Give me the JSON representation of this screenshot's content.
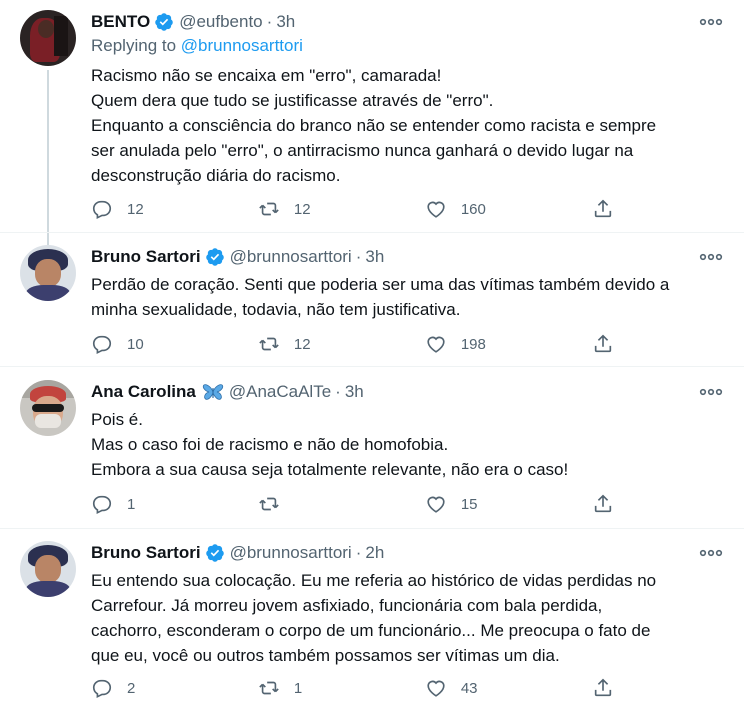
{
  "tweets": [
    {
      "name": "BENTO",
      "verified": true,
      "handle": "@eufbento",
      "separator": "·",
      "time": "3h",
      "reply_prefix": "Replying to ",
      "reply_mention": "@brunnosarttori",
      "text": "Racismo não se encaixa em \"erro\", camarada!\nQuem dera que tudo se justificasse através de \"erro\".\nEnquanto a consciência do branco não se entender como racista e sempre\nser anulada pelo \"erro\", o antirracismo nunca ganhará o devido lugar na\ndesconstrução diária do racismo.",
      "replies": "12",
      "retweets": "12",
      "likes": "160"
    },
    {
      "name": "Bruno Sartori",
      "verified": true,
      "handle": "@brunnosarttori",
      "separator": "·",
      "time": "3h",
      "text": "Perdão de coração. Senti que poderia ser uma das vítimas também devido a\nminha sexualidade, todavia, não tem justificativa.",
      "replies": "10",
      "retweets": "12",
      "likes": "198"
    },
    {
      "name": "Ana Carolina",
      "verified": false,
      "handle": "@AnaCaAlTe",
      "separator": "·",
      "time": "3h",
      "text": "Pois é.\nMas o caso foi de racismo e não de homofobia.\nEmbora a sua causa seja totalmente relevante, não era o caso!",
      "replies": "1",
      "retweets": "",
      "likes": "15"
    },
    {
      "name": "Bruno Sartori",
      "verified": true,
      "handle": "@brunnosarttori",
      "separator": "·",
      "time": "2h",
      "text": "Eu entendo sua colocação. Eu me referia ao histórico de vidas perdidas no\nCarrefour. Já morreu jovem asfixiado, funcionária com bala perdida,\ncachorro, esconderam o corpo de um funcionário... Me preocupa o fato de\nque eu, você ou outros também possamos ser vítimas um dia.",
      "replies": "2",
      "retweets": "1",
      "likes": "43"
    }
  ],
  "icons": {
    "verified": "verified-badge-icon",
    "more": "more-options-icon",
    "reply": "reply-icon",
    "retweet": "retweet-icon",
    "like": "like-icon",
    "share": "share-icon",
    "butterfly": "butterfly-emoji-icon"
  },
  "colors": {
    "accent": "#1d9bf0",
    "secondary_text": "#536471",
    "thread_line": "#cfd9de",
    "divider": "#eff3f4"
  }
}
